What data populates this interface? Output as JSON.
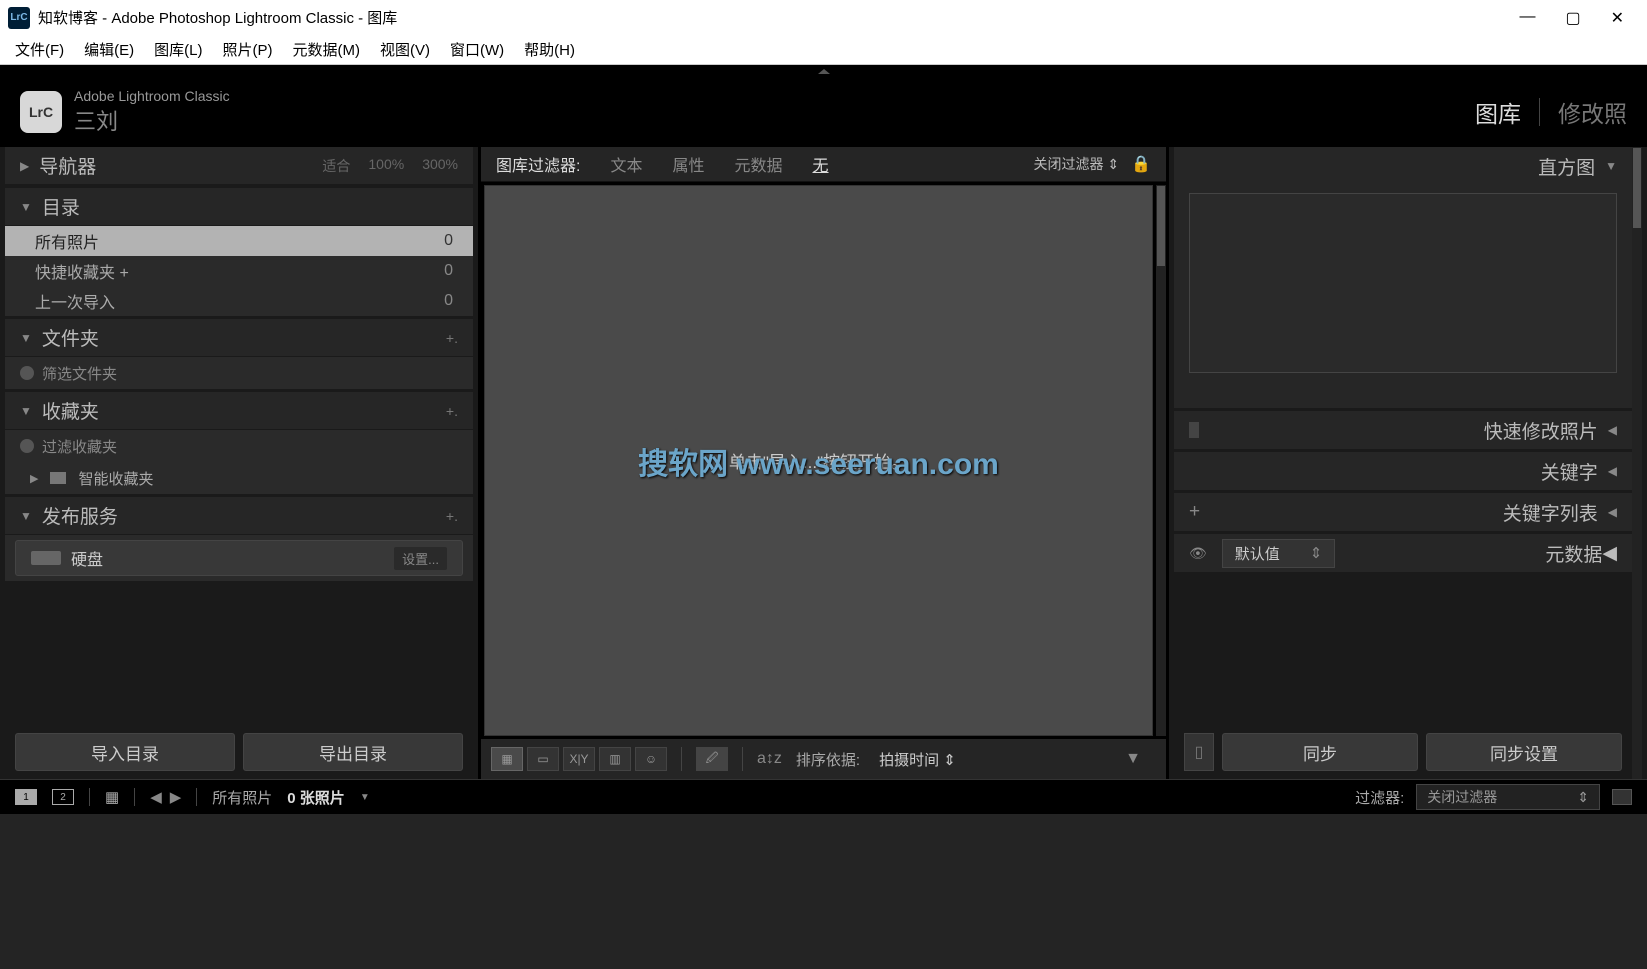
{
  "titlebar": {
    "app_icon": "LrC",
    "title": "知软博客 - Adobe Photoshop Lightroom Classic - 图库"
  },
  "menubar": {
    "file": "文件(F)",
    "edit": "编辑(E)",
    "library": "图库(L)",
    "photo": "照片(P)",
    "metadata": "元数据(M)",
    "view": "视图(V)",
    "window": "窗口(W)",
    "help": "帮助(H)"
  },
  "header": {
    "logo": "LrC",
    "product": "Adobe Lightroom Classic",
    "user": "三刘",
    "module_library": "图库",
    "module_develop": "修改照"
  },
  "left": {
    "navigator": {
      "title": "导航器",
      "fit": "适合",
      "z100": "100%",
      "z300": "300%"
    },
    "catalog": {
      "title": "目录",
      "all_photos": "所有照片",
      "all_photos_count": "0",
      "quick": "快捷收藏夹 +",
      "quick_count": "0",
      "last_import": "上一次导入",
      "last_import_count": "0"
    },
    "folders": {
      "title": "文件夹",
      "filter": "筛选文件夹"
    },
    "collections": {
      "title": "收藏夹",
      "filter": "过滤收藏夹",
      "smart": "智能收藏夹"
    },
    "publish": {
      "title": "发布服务",
      "hdd": "硬盘",
      "settings": "设置..."
    },
    "import_btn": "导入目录",
    "export_btn": "导出目录"
  },
  "filterbar": {
    "label": "图库过滤器:",
    "text": "文本",
    "attr": "属性",
    "meta": "元数据",
    "none": "无",
    "off": "关闭过滤器"
  },
  "canvas": {
    "hint": "单击\"导入...\"按钮开始。",
    "watermark": "搜软网 www.seeruan.com"
  },
  "toolbar": {
    "sort_label": "排序依据:",
    "sort_value": "拍摄时间"
  },
  "right": {
    "histogram": "直方图",
    "quick_dev": "快速修改照片",
    "keywords": "关键字",
    "keyword_list": "关键字列表",
    "metadata": "元数据",
    "default": "默认值",
    "sync": "同步",
    "sync_settings": "同步设置"
  },
  "bottom": {
    "view1": "1",
    "view2": "2",
    "all_photos": "所有照片",
    "count_label": "0 张照片",
    "filter_label": "过滤器:",
    "filter_off": "关闭过滤器"
  }
}
